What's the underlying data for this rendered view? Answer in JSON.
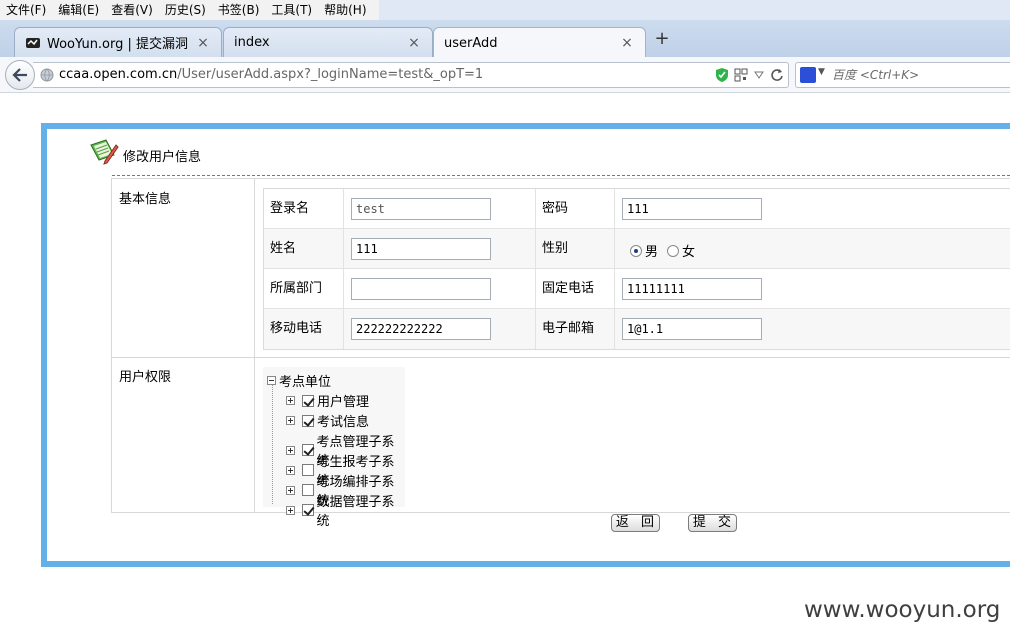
{
  "browser": {
    "menu": [
      "文件(F)",
      "编辑(E)",
      "查看(V)",
      "历史(S)",
      "书签(B)",
      "工具(T)",
      "帮助(H)"
    ],
    "tabs": [
      {
        "label": "WooYun.org | 提交漏洞",
        "close": "×"
      },
      {
        "label": "index",
        "close": "×"
      },
      {
        "label": "userAdd",
        "close": "×"
      }
    ],
    "newtab": "+",
    "url_domain": "ccaa.open.com.cn",
    "url_path": "/User/userAdd.aspx?_loginName=test&_opT=1",
    "search_placeholder": "百度 <Ctrl+K>"
  },
  "page": {
    "title": "修改用户信息",
    "section_basic": "基本信息",
    "section_perm": "用户权限",
    "fields": {
      "login_label": "登录名",
      "login_value": "test",
      "password_label": "密码",
      "password_value": "111",
      "name_label": "姓名",
      "name_value": "111",
      "gender_label": "性别",
      "gender_male": "男",
      "gender_female": "女",
      "dept_label": "所属部门",
      "dept_value": "",
      "phone_label": "固定电话",
      "phone_value": "11111111",
      "mobile_label": "移动电话",
      "mobile_value": "222222222222",
      "email_label": "电子邮箱",
      "email_value": "1@1.1"
    },
    "tree": {
      "root": "考点单位",
      "nodes": [
        {
          "label": "用户管理",
          "checked": true
        },
        {
          "label": "考试信息",
          "checked": true
        },
        {
          "label": "考点管理子系统",
          "checked": true
        },
        {
          "label": "考生报考子系统",
          "checked": false
        },
        {
          "label": "考场编排子系统",
          "checked": false
        },
        {
          "label": "数据管理子系统",
          "checked": true
        }
      ]
    },
    "buttons": {
      "back": "返 回",
      "submit": "提 交"
    }
  },
  "watermark": "www.wooyun.org"
}
